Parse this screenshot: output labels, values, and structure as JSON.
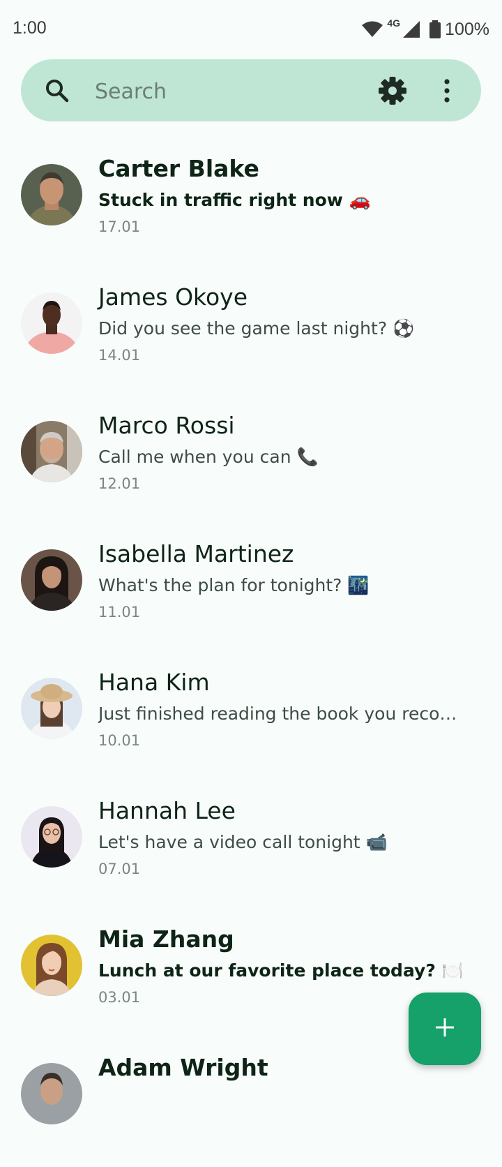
{
  "status_bar": {
    "time": "1:00",
    "network": "4G",
    "battery": "100%"
  },
  "search": {
    "placeholder": "Search"
  },
  "chats": [
    {
      "name": "Carter Blake",
      "message": "Stuck in traffic right now 🚗",
      "date": "17.01",
      "unread": true
    },
    {
      "name": "James  Okoye",
      "message": "Did you see the game last night? ⚽",
      "date": "14.01",
      "unread": false
    },
    {
      "name": "Marco  Rossi",
      "message": "Call me when you can 📞",
      "date": "12.01",
      "unread": false
    },
    {
      "name": "Isabella Martinez",
      "message": "What's the plan for tonight? 🌃",
      "date": "11.01",
      "unread": false
    },
    {
      "name": "Hana Kim",
      "message": "Just finished reading the book you recom...",
      "date": "10.01",
      "unread": false
    },
    {
      "name": "Hannah Lee",
      "message": "Let's have a video call tonight 📹",
      "date": "07.01",
      "unread": false
    },
    {
      "name": "Mia Zhang",
      "message": "Lunch at our favorite place today? 🍽️",
      "date": "03.01",
      "unread": true
    },
    {
      "name": "Adam Wright",
      "message": "",
      "date": "",
      "unread": true
    }
  ],
  "colors": {
    "accent": "#16a06a",
    "search_bg": "#bfe6d5",
    "background": "#f8fcfa"
  },
  "icons": {
    "search": "search-icon",
    "settings": "gear-icon",
    "more": "more-vert-icon",
    "fab": "plus-icon"
  }
}
